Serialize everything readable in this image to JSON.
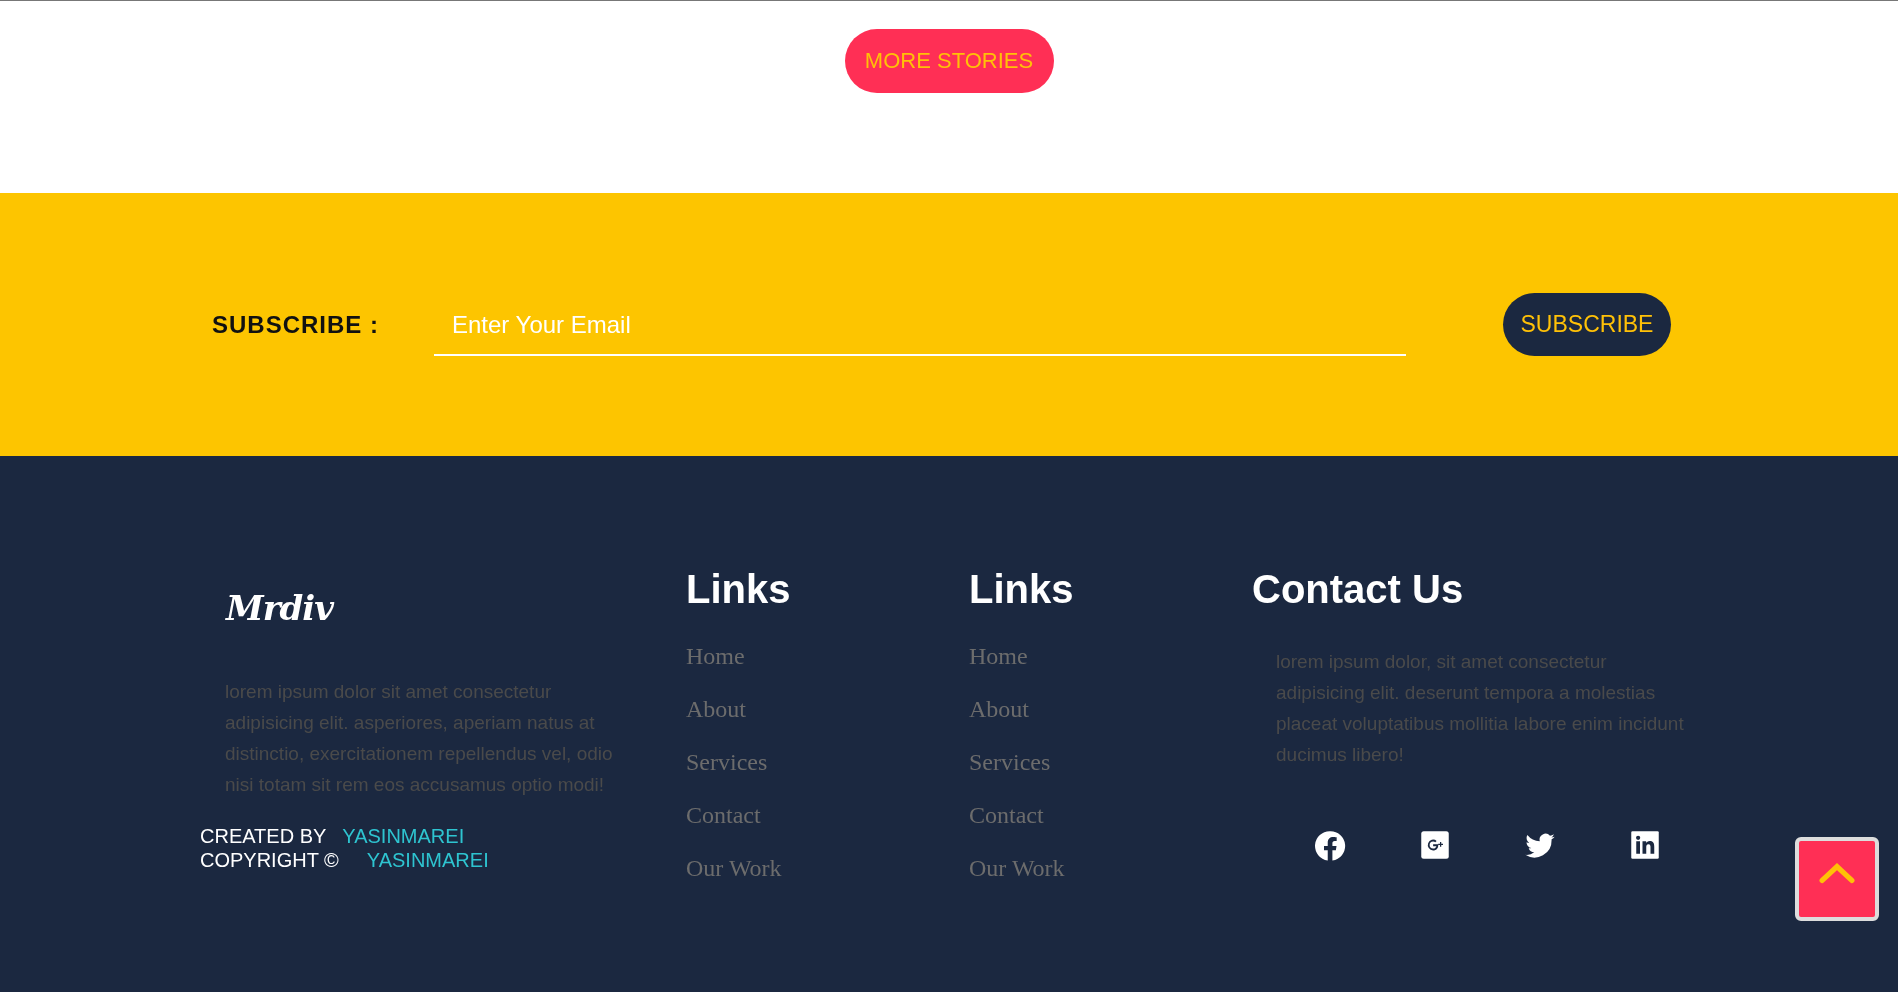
{
  "more_button": "MORE STORIES",
  "subscribe": {
    "label": "SUBSCRIBE :",
    "placeholder": "Enter Your Email",
    "button": "SUBSCRIBE"
  },
  "footer": {
    "logo": "Mrdiv",
    "about": "lorem ipsum dolor sit amet consectetur adipisicing elit. asperiores, aperiam natus at distinctio, exercitationem repellendus vel, odio nisi totam sit rem eos accusamus optio modi!",
    "credits": [
      {
        "label": "CREATED BY",
        "name": "YASINMAREI"
      },
      {
        "label": "COPYRIGHT ©",
        "name": "YASINMAREI"
      }
    ],
    "link_columns": [
      {
        "title": "Links",
        "items": [
          "Home",
          "About",
          "Services",
          "Contact",
          "Our Work"
        ]
      },
      {
        "title": "Links",
        "items": [
          "Home",
          "About",
          "Services",
          "Contact",
          "Our Work"
        ]
      }
    ],
    "contact": {
      "title": "Contact Us",
      "text": "lorem ipsum dolor, sit amet consectetur adipisicing elit. deserunt tempora a molestias placeat voluptatibus mollitia labore enim incidunt ducimus libero!",
      "socials": [
        {
          "kind": "facebook"
        },
        {
          "kind": "googleplus"
        },
        {
          "kind": "twitter"
        },
        {
          "kind": "linkedin"
        }
      ]
    }
  },
  "scroll_top": {
    "kind": "up"
  }
}
